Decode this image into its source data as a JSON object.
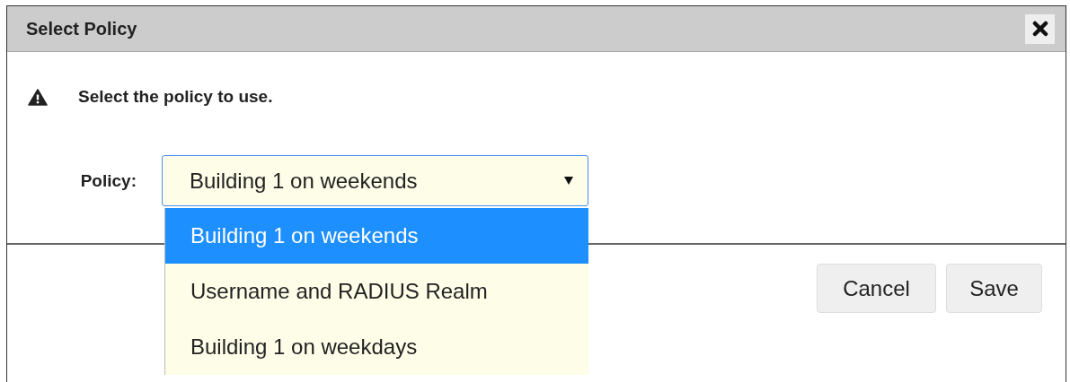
{
  "dialog": {
    "title": "Select Policy",
    "message": "Select the policy to use.",
    "field": {
      "label": "Policy:",
      "value": "Building 1 on weekends",
      "expanded": true,
      "options": [
        {
          "label": "Building 1 on weekends",
          "selected": true
        },
        {
          "label": "Username and RADIUS Realm",
          "selected": false
        },
        {
          "label": "Building 1 on weekdays",
          "selected": false
        }
      ]
    },
    "buttons": [
      "Cancel",
      "Save"
    ]
  }
}
